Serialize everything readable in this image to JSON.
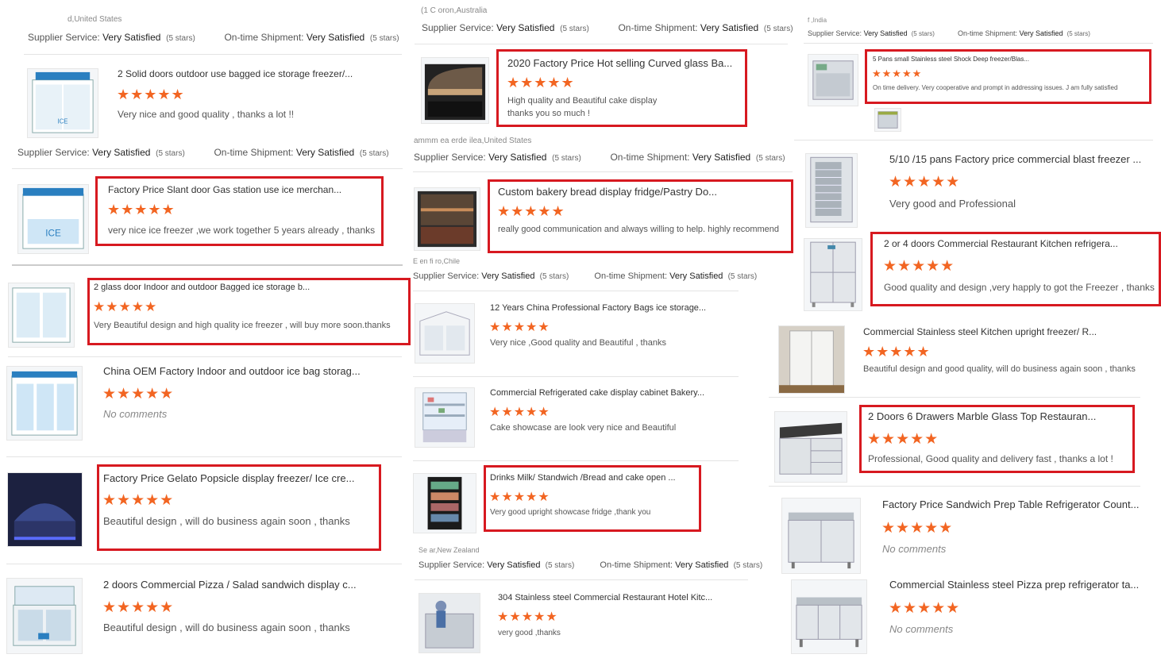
{
  "rating": {
    "star_color": "#f26522",
    "highlight_color": "#d71920",
    "stars": "★★★★★",
    "value": 5,
    "max": 5
  },
  "labels": {
    "supplier_service": "Supplier Service:",
    "ontime_shipment": "On-time Shipment:",
    "very_satisfied": "Very Satisfied",
    "five_stars": "(5 stars)"
  },
  "locations": {
    "c1_top": "d,United States",
    "c2_top": "(1 C oron,Australia",
    "c3_top": "f  ,India",
    "c2_a": "ammm ea erde ilea,United States",
    "c2_b": "E   en fi   ro,Chile",
    "c2_c": "Se          ar,New Zealand"
  },
  "col1": [
    {
      "title": "2 Solid doors outdoor use bagged ice storage freezer/...",
      "comment": "Very nice and good quality , thanks a lot !!",
      "icon": "bagged-ice-storage-freezer-icon"
    },
    {
      "title": "Factory Price Slant door Gas station use ice merchan...",
      "comment": "very nice ice freezer ,we work together 5 years already , thanks",
      "icon": "ice-merchandiser-icon"
    },
    {
      "title": "2 glass door Indoor and outdoor Bagged ice storage b...",
      "comment": "Very Beautiful design and high quality ice freezer , will buy more soon.thanks",
      "icon": "glass-door-ice-storage-icon"
    },
    {
      "title": "China OEM Factory Indoor and outdoor ice bag storag...",
      "comment": "No comments",
      "icon": "ice-bag-storage-icon"
    },
    {
      "title": "Factory Price Gelato Popsicle display freezer/ Ice cre...",
      "comment": "Beautiful design , will do business again soon , thanks",
      "icon": "gelato-display-freezer-icon"
    },
    {
      "title": "2 doors Commercial Pizza / Salad sandwich display c...",
      "comment": "Beautiful design , will do business again soon , thanks",
      "icon": "pizza-salad-display-icon"
    }
  ],
  "col2": [
    {
      "title": "2020 Factory Price Hot selling Curved glass Ba...",
      "comment_l1": "High quality and Beautiful cake display",
      "comment_l2": "thanks you so much !",
      "icon": "curved-glass-cake-display-icon"
    },
    {
      "title": "Custom bakery bread display fridge/Pastry Do...",
      "comment": "really good communication and always willing to help. highly recommend",
      "icon": "bakery-display-fridge-icon"
    },
    {
      "title": "12 Years China Professional Factory Bags ice storage...",
      "comment": "Very nice ,Good quality and Beautiful , thanks",
      "icon": "bags-ice-storage-icon"
    },
    {
      "title": "Commercial Refrigerated cake display cabinet Bakery...",
      "comment": "Cake showcase are look very nice and Beautiful",
      "icon": "cake-display-cabinet-icon"
    },
    {
      "title": "Drinks Milk/ Standwich /Bread and cake open ...",
      "comment": "Very good upright showcase fridge ,thank you",
      "icon": "open-showcase-fridge-icon"
    },
    {
      "title": "304 Stainless steel Commercial Restaurant Hotel Kitc...",
      "comment": "very good ,thanks",
      "icon": "stainless-kitchen-freezer-icon"
    }
  ],
  "col3": [
    {
      "title": "5 Pans small Stainless steel Shock Deep freezer/Blas...",
      "comment": "On time delivery. Very cooperative and prompt in addressing issues. J am fully satisfied",
      "icon": "blast-freezer-icon"
    },
    {
      "title": "5/10 /15 pans Factory price commercial blast freezer ...",
      "comment": "Very good and Professional",
      "icon": "pan-blast-freezer-icon"
    },
    {
      "title": "2 or 4 doors Commercial Restaurant Kitchen refrigera...",
      "comment": "Good quality and design ,very happly to got the Freezer , thanks",
      "icon": "kitchen-refrigerator-icon"
    },
    {
      "title": "Commercial Stainless steel Kitchen upright freezer/ R...",
      "comment": "Beautiful design and good quality, will do business again soon , thanks",
      "icon": "upright-freezer-icon"
    },
    {
      "title": "2 Doors 6 Drawers Marble Glass Top Restauran...",
      "comment": "Professional, Good quality and delivery fast , thanks a lot !",
      "icon": "marble-top-counter-icon"
    },
    {
      "title": "Factory Price Sandwich Prep Table Refrigerator Count...",
      "comment": "No comments",
      "icon": "sandwich-prep-table-icon"
    },
    {
      "title": "Commercial Stainless steel Pizza prep refrigerator ta...",
      "comment": "No comments",
      "icon": "pizza-prep-refrigerator-icon"
    }
  ]
}
